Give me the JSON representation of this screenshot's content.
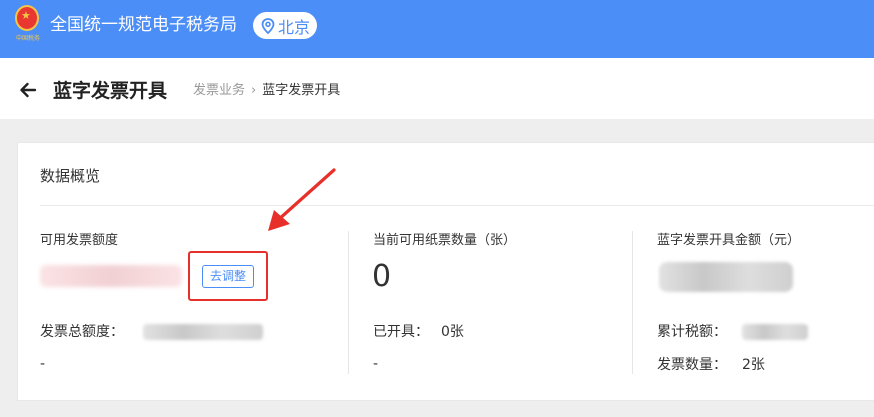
{
  "topbar": {
    "site_title": "全国统一规范电子税务局",
    "city": "北京",
    "emblem_text": "中国税务",
    "icons": {
      "emblem": "tax-emblem-icon",
      "location": "location-pin-icon"
    }
  },
  "header": {
    "page_title": "蓝字发票开具",
    "breadcrumb": [
      "发票业务",
      "蓝字发票开具"
    ],
    "breadcrumb_separator": "›",
    "icons": {
      "back": "back-arrow-icon"
    }
  },
  "overview": {
    "title": "数据概览",
    "col1": {
      "label": "可用发票额度",
      "adjust_button": "去调整",
      "total_label": "发票总额度：",
      "dash": "-"
    },
    "col2": {
      "label": "当前可用纸票数量（张）",
      "value": "0",
      "issued_label": "已开具：",
      "issued_value": "0张",
      "dash": "-"
    },
    "col3": {
      "label": "蓝字发票开具金额（元）",
      "tax_label": "累计税额：",
      "count_label": "发票数量：",
      "count_value": "2张"
    }
  },
  "colors": {
    "brand_blue": "#4c8ef7",
    "highlight_red": "#e8302a"
  }
}
